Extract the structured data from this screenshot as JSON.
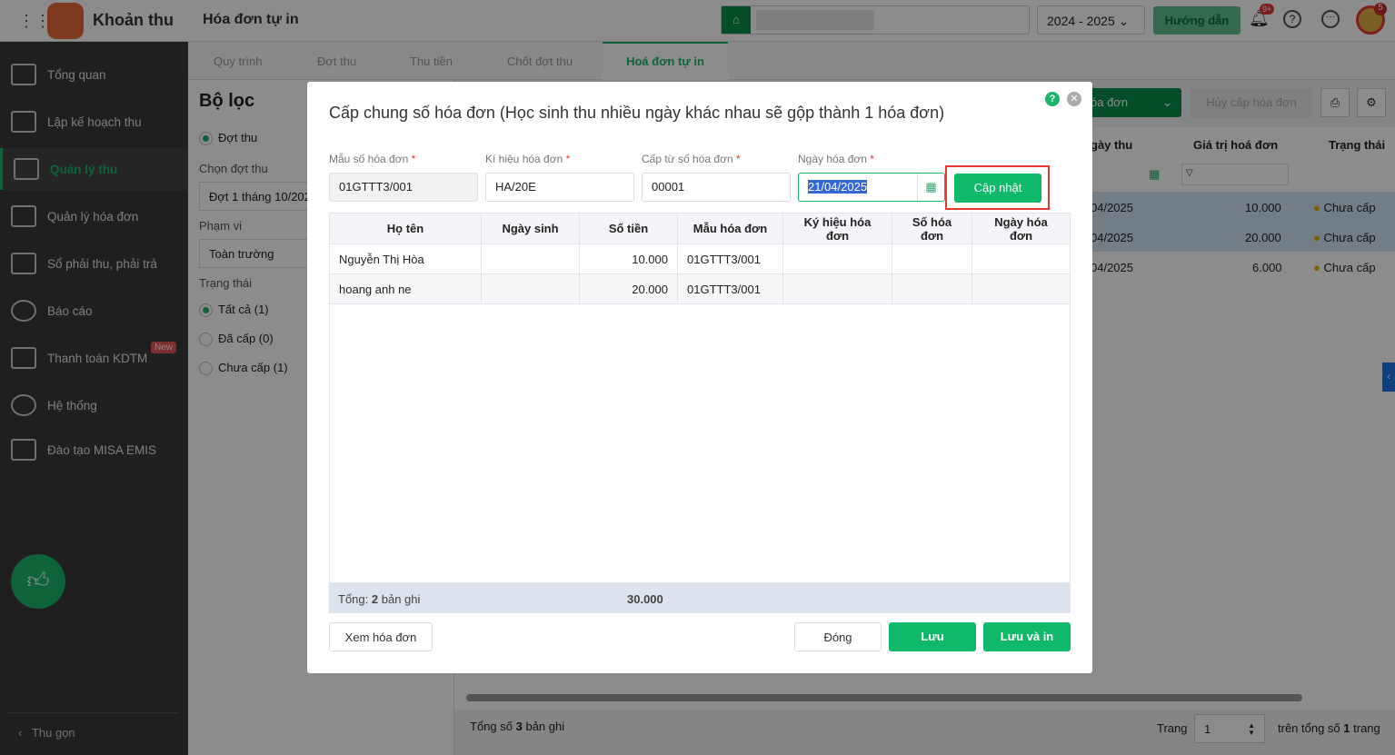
{
  "topbar": {
    "app_title": "Khoản thu",
    "page_title": "Hóa đơn tự in",
    "year": "2024 - 2025",
    "guide": "Hướng dẫn",
    "notif_badge": "9+",
    "avatar_badge": "5"
  },
  "sidebar": {
    "items": [
      {
        "label": "Tổng quan"
      },
      {
        "label": "Lập kế hoạch thu"
      },
      {
        "label": "Quản lý thu"
      },
      {
        "label": "Quản lý hóa đơn"
      },
      {
        "label": "Sổ phải thu, phải trả"
      },
      {
        "label": "Báo cáo"
      },
      {
        "label": "Thanh toán KDTM",
        "badge": "New"
      },
      {
        "label": "Hệ thống"
      },
      {
        "label": "Đào tạo MISA EMIS"
      }
    ],
    "collapse": "Thu gọn"
  },
  "tabs": [
    "Quy trình",
    "Đợt thu",
    "Thu tiền",
    "Chốt đợt thu",
    "Hoá đơn tự in"
  ],
  "filter": {
    "title": "Bộ lọc",
    "mode": "Đợt thu",
    "choose_label": "Chọn đợt thu",
    "choose_value": "Đợt 1 tháng 10/202",
    "scope_label": "Phạm vi",
    "scope_value": "Toàn trường",
    "status_label": "Trạng thái",
    "status_options": [
      "Tất cả (1)",
      "Đã cấp (0)",
      "Chưa cấp (1)"
    ]
  },
  "bg_table": {
    "issue_btn": "óa đơn",
    "cancel_btn": "Hủy cấp hóa đơn",
    "headers": [
      "gày thu",
      "Giá trị hoá đơn",
      "Trạng thái"
    ],
    "rows": [
      [
        "04/2025",
        "10.000",
        "Chưa cấp"
      ],
      [
        "04/2025",
        "20.000",
        "Chưa cấp"
      ],
      [
        "04/2025",
        "6.000",
        "Chưa cấp"
      ]
    ],
    "total_prefix": "Tổng số",
    "total_count": "3",
    "total_suffix": "bản ghi",
    "page_label": "Trang",
    "page_value": "1",
    "page_total_prefix": "trên tổng số",
    "page_total": "1",
    "page_total_suffix": "trang"
  },
  "modal": {
    "title": "Cấp chung số hóa đơn (Học sinh thu nhiều ngày khác nhau sẽ gộp thành 1 hóa đơn)",
    "fields": [
      {
        "label": "Mẫu số hóa đơn",
        "value": "01GTTT3/001"
      },
      {
        "label": "Kí hiệu hóa đơn",
        "value": "HA/20E"
      },
      {
        "label": "Cấp từ số hóa đơn",
        "value": "00001"
      },
      {
        "label": "Ngày hóa đơn",
        "value": "21/04/2025"
      }
    ],
    "required_mark": "*",
    "update_btn": "Cập nhật",
    "headers": [
      "Họ tên",
      "Ngày sinh",
      "Số tiền",
      "Mẫu hóa đơn",
      "Ký hiệu hóa đơn",
      "Số hóa đơn",
      "Ngày hóa đơn"
    ],
    "rows": [
      [
        "Nguyễn Thị Hòa",
        "",
        "10.000",
        "01GTTT3/001",
        "",
        "",
        ""
      ],
      [
        "hoang anh ne",
        "",
        "20.000",
        "01GTTT3/001",
        "",
        "",
        ""
      ]
    ],
    "footer_label": "Tổng:",
    "footer_count": "2",
    "footer_suffix": "bản ghi",
    "footer_total": "30.000",
    "view_btn": "Xem hóa đơn",
    "close_btn": "Đóng",
    "save_btn": "Lưu",
    "save_print_btn": "Lưu và in"
  }
}
